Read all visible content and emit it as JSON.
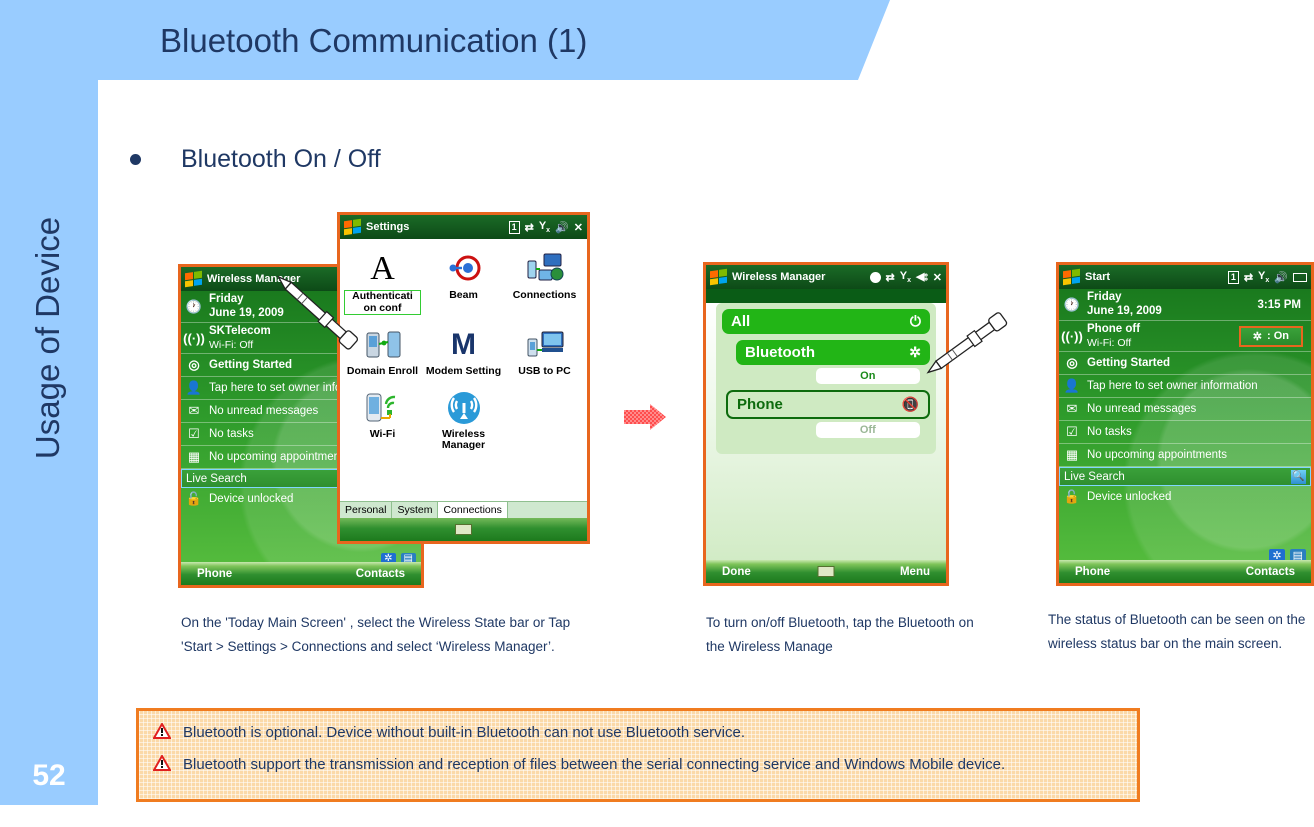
{
  "header": {
    "title": "Bluetooth Communication (1)"
  },
  "sidebar": {
    "label": "Usage of Device",
    "page_number": "52"
  },
  "body": {
    "bullet": "Bluetooth On / Off"
  },
  "colors": {
    "header_blue": "#99ccff",
    "title_navy": "#1f3864",
    "device_border_orange": "#e8661e",
    "warning_border": "#f07c20",
    "warning_fill": "#fbd9a8",
    "wm_green": "#22b516",
    "arrow_red": "#ff6666"
  },
  "device1": {
    "titlebar": {
      "title": "Wireless Manager",
      "icons": [
        "boxed-1-icon",
        "sync-icon",
        "signal-off-icon",
        "volume-icon",
        "close-icon"
      ]
    },
    "rows": [
      {
        "icon": "clock-icon",
        "line1": "Friday",
        "line2": "June 19, 2009",
        "bold": true
      },
      {
        "icon": "wireless-icon",
        "line1": "SKTelecom",
        "line2": "Wi-Fi: Off",
        "bold": true
      },
      {
        "icon": "getting-started-icon",
        "line1": "Getting Started",
        "bold": true
      },
      {
        "icon": "owner-icon",
        "line1": "Tap here to set owner information"
      },
      {
        "icon": "messages-icon",
        "line1": "No unread messages"
      },
      {
        "icon": "tasks-icon",
        "line1": "No tasks"
      },
      {
        "icon": "calendar-icon",
        "line1": "No upcoming appointments"
      }
    ],
    "search_placeholder": "Live Search",
    "lock_row": {
      "icon": "unlock-icon",
      "text": "Device unlocked"
    },
    "tray_icons": [
      "bluetooth-tray-icon",
      "connection-tray-icon"
    ],
    "softkeys": {
      "left": "Phone",
      "right": "Contacts"
    }
  },
  "settings": {
    "titlebar": {
      "title": "Settings",
      "icons": [
        "boxed-1-icon",
        "sync-icon",
        "signal-off-icon",
        "volume-icon",
        "close-icon"
      ]
    },
    "items": [
      {
        "label": "Authenticati on conf",
        "icon": "letter-a-icon",
        "selected": true
      },
      {
        "label": "Beam",
        "icon": "beam-icon",
        "selected": false
      },
      {
        "label": "Connections",
        "icon": "connections-icon",
        "selected": false
      },
      {
        "label": "Domain Enroll",
        "icon": "domain-enroll-icon",
        "selected": false
      },
      {
        "label": "Modem Setting",
        "icon": "letter-m-icon",
        "selected": false
      },
      {
        "label": "USB to PC",
        "icon": "usb-to-pc-icon",
        "selected": false
      },
      {
        "label": "Wi-Fi",
        "icon": "wifi-icon",
        "selected": false
      },
      {
        "label": "Wireless Manager",
        "icon": "wireless-manager-icon",
        "selected": false
      }
    ],
    "tabs": [
      {
        "label": "Personal",
        "active": false
      },
      {
        "label": "System",
        "active": false
      },
      {
        "label": "Connections",
        "active": true
      }
    ]
  },
  "device2": {
    "titlebar": {
      "title": "Wireless Manager",
      "icons": [
        "circle-icon",
        "sync-icon",
        "signal-off-icon",
        "speaker-icon",
        "close-icon"
      ]
    },
    "all_row": {
      "label": "All",
      "icon": "power-icon"
    },
    "bluetooth_row": {
      "label": "Bluetooth",
      "icon": "bluetooth-icon",
      "state": "On"
    },
    "phone_row": {
      "label": "Phone",
      "icon": "phone-off-icon",
      "state": "Off"
    },
    "softkeys": {
      "left": "Done",
      "right": "Menu"
    }
  },
  "device3": {
    "titlebar": {
      "title": "Start",
      "icons": [
        "boxed-1-icon",
        "sync-icon",
        "signal-off-icon",
        "volume-icon",
        "battery-icon"
      ]
    },
    "rows": [
      {
        "icon": "clock-icon",
        "line1": "Friday",
        "line2": "June 19, 2009",
        "time": "3:15 PM",
        "bold": true
      },
      {
        "icon": "wireless-icon",
        "line1": "Phone off",
        "line2": "Wi-Fi: Off",
        "bold": true,
        "status": ": On",
        "status_icon": "bluetooth-icon"
      },
      {
        "icon": "getting-started-icon",
        "line1": "Getting Started",
        "bold": true
      },
      {
        "icon": "owner-icon",
        "line1": "Tap here to set owner information"
      },
      {
        "icon": "messages-icon",
        "line1": "No unread messages"
      },
      {
        "icon": "tasks-icon",
        "line1": "No tasks"
      },
      {
        "icon": "calendar-icon",
        "line1": "No upcoming appointments"
      }
    ],
    "search_placeholder": "Live Search",
    "lock_row": {
      "icon": "unlock-icon",
      "text": "Device unlocked"
    },
    "tray_icons": [
      "bluetooth-tray-icon",
      "connection-tray-icon"
    ],
    "softkeys": {
      "left": "Phone",
      "right": "Contacts"
    }
  },
  "captions": {
    "one": "On the 'Today Main Screen' , select the Wireless State bar or Tap 'Start > Settings > Connections and select ‘Wireless Manager’.",
    "two": "To turn on/off Bluetooth, tap the Bluetooth on the Wireless Manage",
    "three": "The status of Bluetooth can be seen on the wireless status bar on the main screen."
  },
  "warnings": [
    "Bluetooth is optional. Device without built-in Bluetooth can not use Bluetooth service.",
    "Bluetooth support the transmission and reception of files between the serial connecting service and Windows Mobile device."
  ]
}
